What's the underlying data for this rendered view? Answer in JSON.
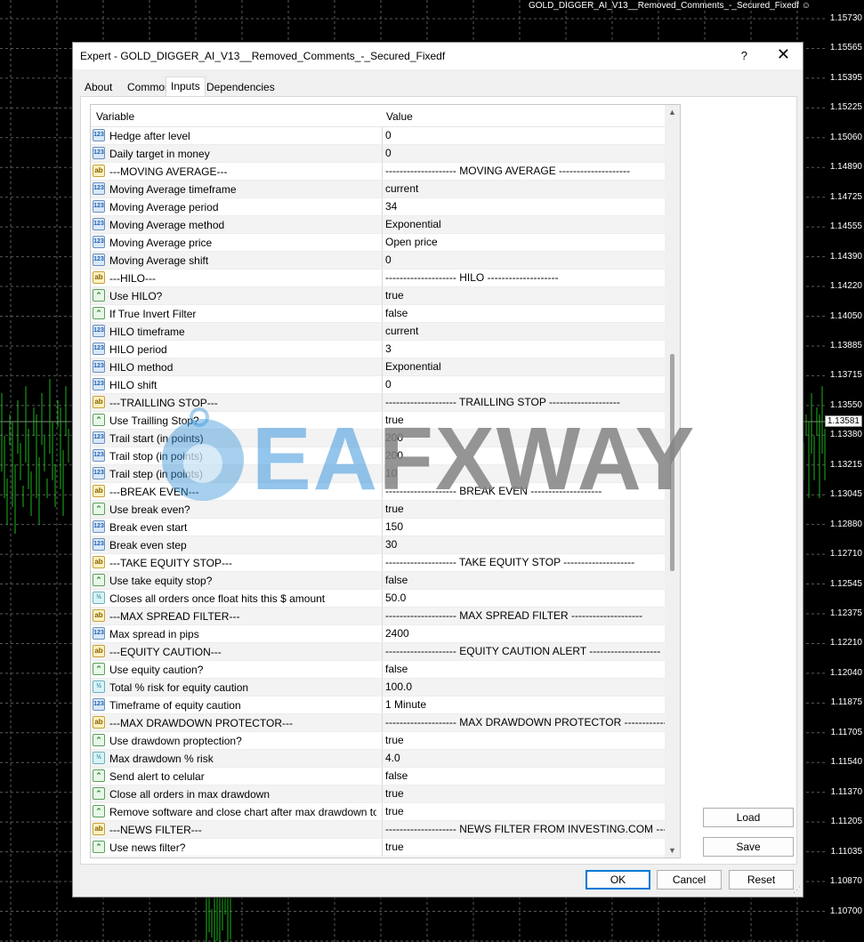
{
  "chart": {
    "title": "GOLD_DIGGER_AI_V13__Removed_Comments_-_Secured_Fixedf ☺",
    "prices": [
      "1.15730",
      "1.15565",
      "1.15395",
      "1.15225",
      "1.15060",
      "1.14890",
      "1.14725",
      "1.14555",
      "1.14390",
      "1.14220",
      "1.14050",
      "1.13885",
      "1.13715",
      "1.13550",
      "1.13380",
      "1.13215",
      "1.13045",
      "1.12880",
      "1.12710",
      "1.12545",
      "1.12375",
      "1.12210",
      "1.12040",
      "1.11875",
      "1.11705",
      "1.11540",
      "1.11370",
      "1.11205",
      "1.11035",
      "1.10870",
      "1.10700"
    ],
    "current_price": "1.13581"
  },
  "dialog": {
    "title": "Expert - GOLD_DIGGER_AI_V13__Removed_Comments_-_Secured_Fixedf",
    "help": "?",
    "close": "✕",
    "tabs": [
      {
        "label": "About"
      },
      {
        "label": "Common"
      },
      {
        "label": "Inputs"
      },
      {
        "label": "Dependencies"
      }
    ],
    "active_tab": "Inputs",
    "columns": {
      "variable": "Variable",
      "value": "Value"
    },
    "rows": [
      {
        "icon": "int",
        "variable": "Hedge after level",
        "value": "0"
      },
      {
        "icon": "int",
        "variable": "Daily target in money",
        "value": "0"
      },
      {
        "icon": "str",
        "variable": "---MOVING AVERAGE---",
        "value": "-------------------- MOVING AVERAGE --------------------"
      },
      {
        "icon": "int",
        "variable": "Moving Average timeframe",
        "value": "current"
      },
      {
        "icon": "int",
        "variable": "Moving Average period",
        "value": "34"
      },
      {
        "icon": "int",
        "variable": "Moving Average method",
        "value": "Exponential"
      },
      {
        "icon": "int",
        "variable": "Moving Average price",
        "value": "Open price"
      },
      {
        "icon": "int",
        "variable": "Moving Average shift",
        "value": "0"
      },
      {
        "icon": "str",
        "variable": "---HILO---",
        "value": "-------------------- HILO --------------------"
      },
      {
        "icon": "bool",
        "variable": "Use HILO?",
        "value": "true"
      },
      {
        "icon": "bool",
        "variable": "If True Invert Filter",
        "value": "false"
      },
      {
        "icon": "int",
        "variable": "HILO timeframe",
        "value": "current"
      },
      {
        "icon": "int",
        "variable": "HILO period",
        "value": "3"
      },
      {
        "icon": "int",
        "variable": "HILO method",
        "value": "Exponential"
      },
      {
        "icon": "int",
        "variable": "HILO shift",
        "value": "0"
      },
      {
        "icon": "str",
        "variable": "---TRAILLING STOP---",
        "value": "-------------------- TRAILLING STOP --------------------"
      },
      {
        "icon": "bool",
        "variable": "Use Trailling Stop?",
        "value": "true"
      },
      {
        "icon": "int",
        "variable": "Trail start     (in points)",
        "value": "200"
      },
      {
        "icon": "int",
        "variable": "Trail stop      (in points)",
        "value": "200"
      },
      {
        "icon": "int",
        "variable": "Trail step      (in points)",
        "value": "10"
      },
      {
        "icon": "str",
        "variable": "---BREAK EVEN---",
        "value": "-------------------- BREAK EVEN --------------------"
      },
      {
        "icon": "bool",
        "variable": "Use break even?",
        "value": "true"
      },
      {
        "icon": "int",
        "variable": "Break even start",
        "value": "150"
      },
      {
        "icon": "int",
        "variable": "Break even step",
        "value": "30"
      },
      {
        "icon": "str",
        "variable": "---TAKE EQUITY STOP---",
        "value": "-------------------- TAKE EQUITY STOP --------------------"
      },
      {
        "icon": "bool",
        "variable": "Use take equity stop?",
        "value": "false"
      },
      {
        "icon": "dbl",
        "variable": "Closes all orders once float hits this $ amount",
        "value": "50.0"
      },
      {
        "icon": "str",
        "variable": "---MAX SPREAD FILTER---",
        "value": "-------------------- MAX SPREAD FILTER --------------------"
      },
      {
        "icon": "int",
        "variable": "Max spread in pips",
        "value": "2400"
      },
      {
        "icon": "str",
        "variable": "---EQUITY CAUTION---",
        "value": "-------------------- EQUITY CAUTION ALERT --------------------"
      },
      {
        "icon": "bool",
        "variable": "Use equity caution?",
        "value": "false"
      },
      {
        "icon": "dbl",
        "variable": "Total % risk for equity caution",
        "value": "100.0"
      },
      {
        "icon": "int",
        "variable": "Timeframe of equity caution",
        "value": "1 Minute"
      },
      {
        "icon": "str",
        "variable": "---MAX DRAWDOWN PROTECTOR---",
        "value": "-------------------- MAX DRAWDOWN PROTECTOR ---------------"
      },
      {
        "icon": "bool",
        "variable": "Use drawdown proptection?",
        "value": "true"
      },
      {
        "icon": "dbl",
        "variable": "Max drawdown % risk",
        "value": "4.0"
      },
      {
        "icon": "bool",
        "variable": "Send alert to celular",
        "value": "false"
      },
      {
        "icon": "bool",
        "variable": "Close all orders in max drawdown",
        "value": "true"
      },
      {
        "icon": "bool",
        "variable": "Remove software and close chart after max drawdown to stop...",
        "value": "true"
      },
      {
        "icon": "str",
        "variable": "---NEWS FILTER---",
        "value": "-------------------- NEWS FILTER FROM INVESTING.COM ----------------..."
      },
      {
        "icon": "bool",
        "variable": "Use news filter?",
        "value": "true"
      }
    ],
    "icon_glyphs": {
      "int": "123",
      "str": "ab",
      "bool": "⌃",
      "dbl": "½"
    },
    "side_buttons": {
      "load": "Load",
      "save": "Save"
    },
    "footer_buttons": {
      "ok": "OK",
      "cancel": "Cancel",
      "reset": "Reset"
    }
  },
  "watermark": {
    "text_ea": "EA",
    "text_rest": "FXWAY"
  }
}
